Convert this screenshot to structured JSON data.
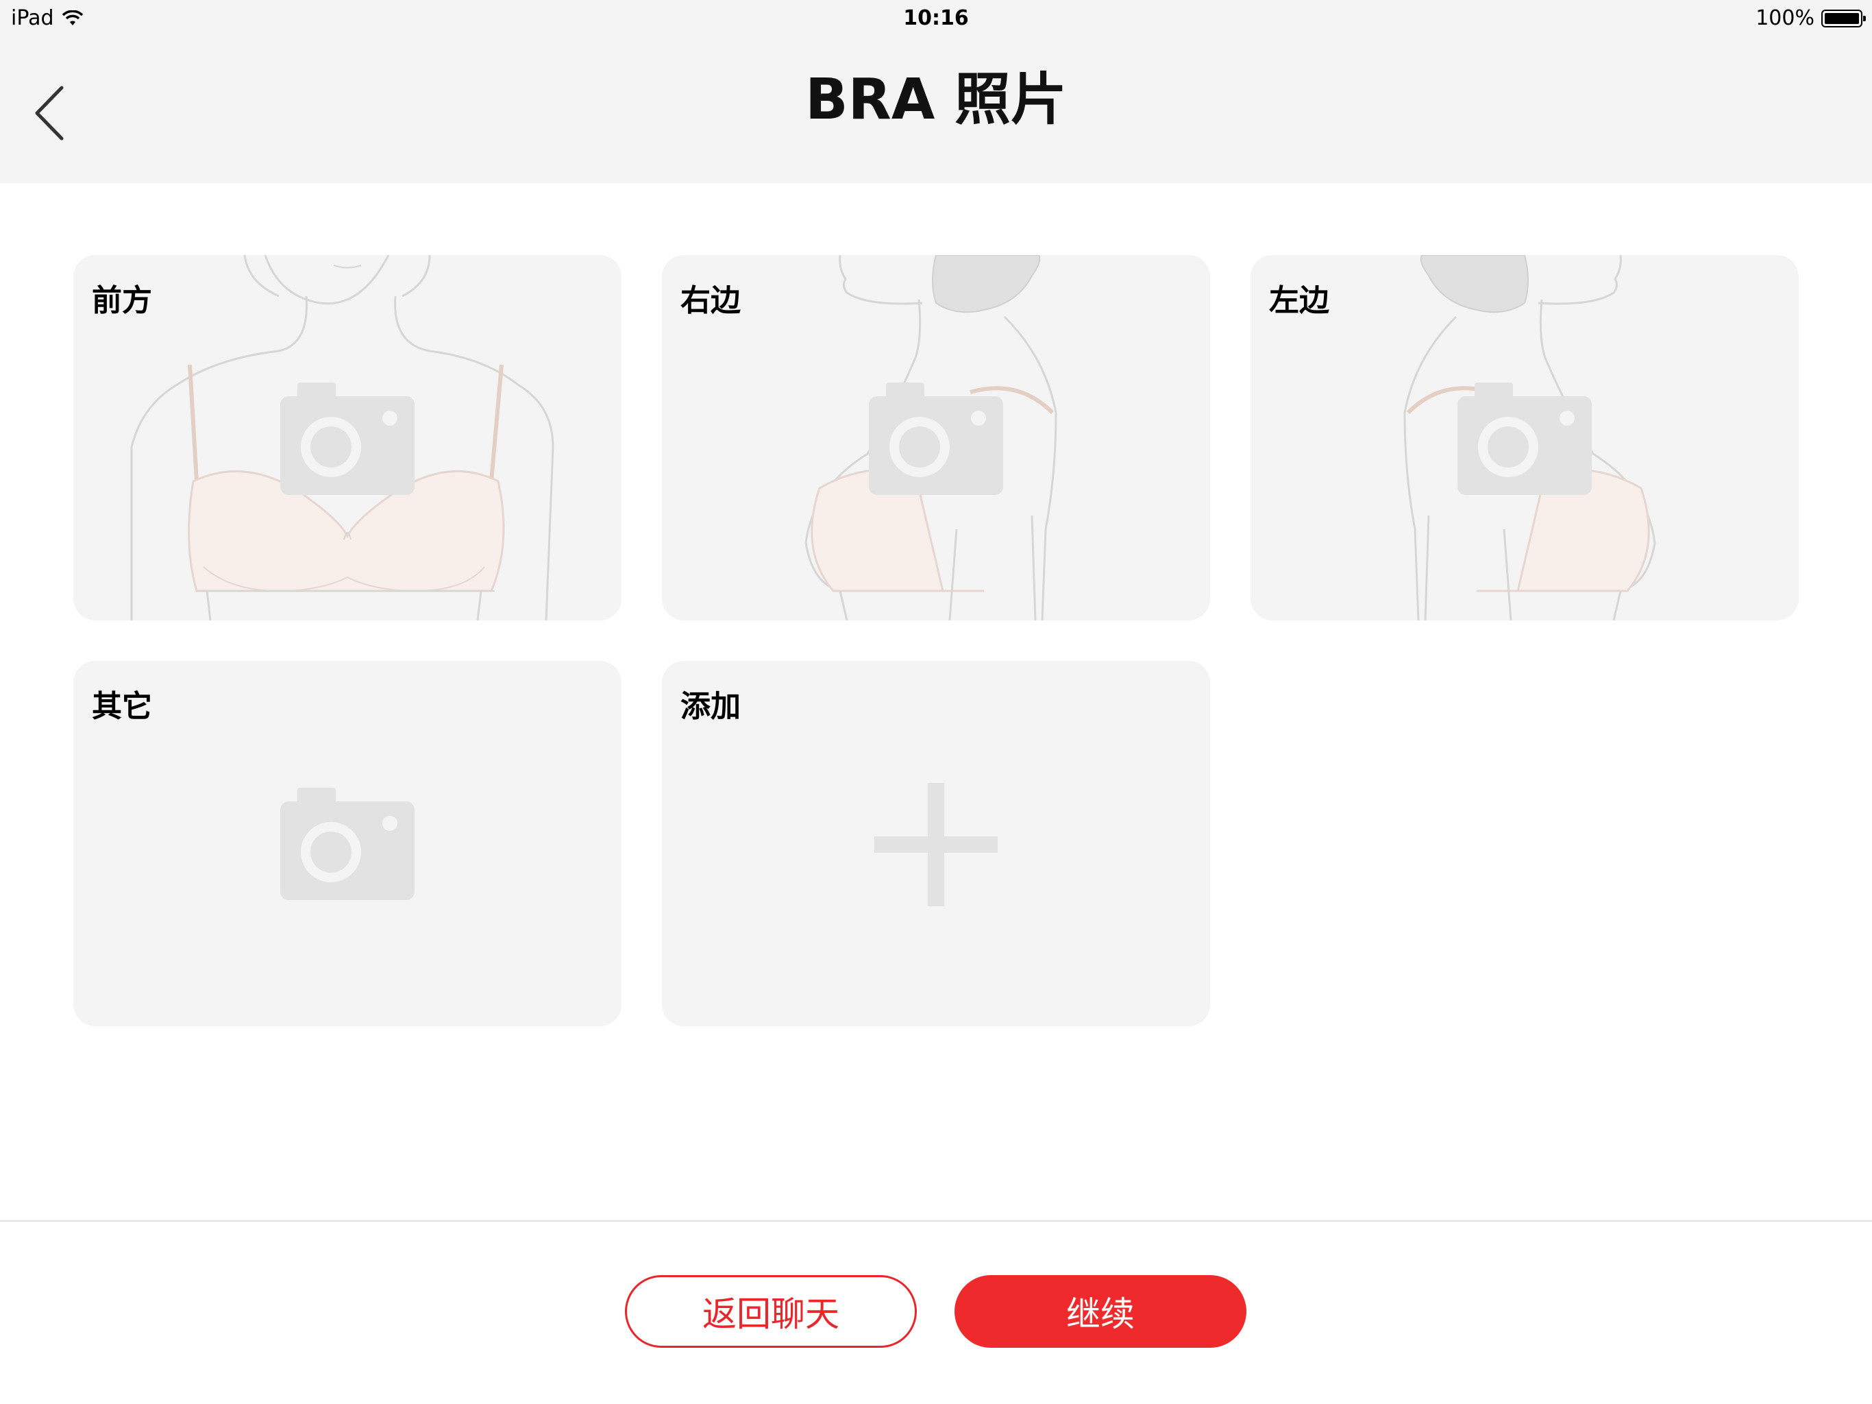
{
  "status_bar": {
    "device": "iPad",
    "time": "10:16",
    "battery": "100%"
  },
  "nav": {
    "title": "BRA 照片",
    "back_icon": "chevron-left-icon"
  },
  "cards": [
    {
      "label": "前方",
      "icon": "camera-icon"
    },
    {
      "label": "右边",
      "icon": "camera-icon"
    },
    {
      "label": "左边",
      "icon": "camera-icon"
    },
    {
      "label": "其它",
      "icon": "camera-icon"
    },
    {
      "label": "添加",
      "icon": "plus-icon"
    }
  ],
  "footer": {
    "back_chat_label": "返回聊天",
    "continue_label": "继续"
  },
  "colors": {
    "accent": "#ee2a2c",
    "card_bg": "#f4f4f4",
    "header_bg": "#f4f4f4",
    "icon_gray": "#e2e2e2"
  }
}
